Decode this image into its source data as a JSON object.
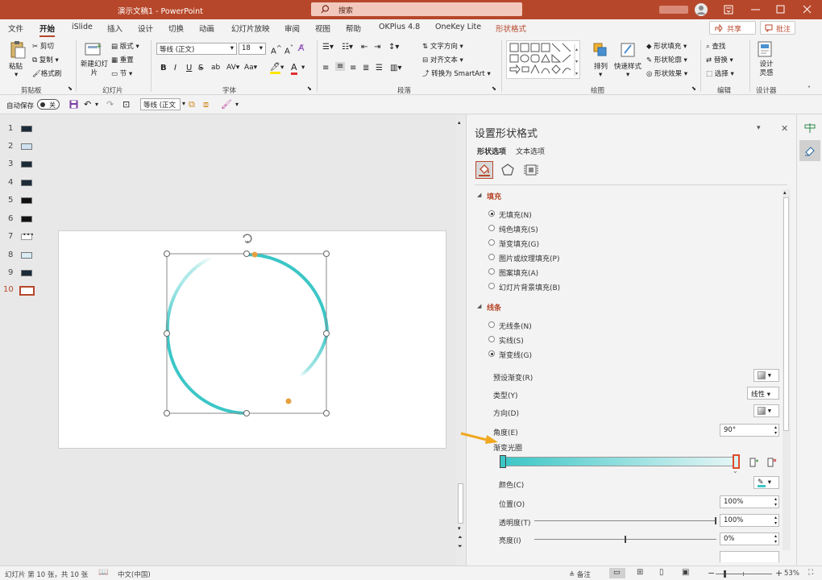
{
  "titlebar": {
    "doc_title": "演示文稿1 - PowerPoint",
    "search_placeholder": "搜索"
  },
  "tabs": [
    {
      "label": "文件"
    },
    {
      "label": "开始",
      "active": true
    },
    {
      "label": "iSlide"
    },
    {
      "label": "插入"
    },
    {
      "label": "设计"
    },
    {
      "label": "切换"
    },
    {
      "label": "动画"
    },
    {
      "label": "幻灯片放映"
    },
    {
      "label": "审阅"
    },
    {
      "label": "视图"
    },
    {
      "label": "帮助"
    },
    {
      "label": "OKPlus 4.8"
    },
    {
      "label": "OneKey Lite"
    },
    {
      "label": "形状格式"
    }
  ],
  "share_label": "共享",
  "comment_label": "批注",
  "ribbon": {
    "clipboard": {
      "paste": "粘贴",
      "cut": "剪切",
      "copy": "复制",
      "format_painter": "格式刷",
      "group": "剪贴板"
    },
    "slides": {
      "new_slide": "新建幻灯片",
      "layout": "版式",
      "reset": "重置",
      "section": "节",
      "group": "幻灯片"
    },
    "font": {
      "name": "等线 (正文)",
      "size": "18",
      "group": "字体",
      "bold": "B",
      "italic": "I",
      "underline": "U",
      "strike": "S",
      "shadow": "ab",
      "spacing": "AV",
      "case": "Aa"
    },
    "paragraph": {
      "text_direction": "文字方向",
      "align_text": "对齐文本",
      "smartart": "转换为 SmartArt",
      "group": "段落"
    },
    "drawing": {
      "arrange": "排列",
      "quick_styles": "快速样式",
      "fill": "形状填充",
      "outline": "形状轮廓",
      "effects": "形状效果",
      "group": "绘图"
    },
    "editing": {
      "find": "查找",
      "replace": "替换",
      "select": "选择",
      "group": "编辑"
    },
    "designer": {
      "ideas": "设计灵感",
      "group": "设计器"
    }
  },
  "qat": {
    "autosave_label": "自动保存",
    "autosave_state": "关",
    "font_combo": "等线 (正文"
  },
  "slides_panel": {
    "numbers": [
      "1",
      "2",
      "3",
      "4",
      "5",
      "6",
      "7",
      "8",
      "9",
      "10"
    ],
    "selected": "10"
  },
  "format_pane": {
    "title": "设置形状格式",
    "tab_shape": "形状选项",
    "tab_text": "文本选项",
    "fill_header": "填充",
    "fill_options": [
      "无填充(N)",
      "纯色填充(S)",
      "渐变填充(G)",
      "图片或纹理填充(P)",
      "图案填充(A)",
      "幻灯片背景填充(B)"
    ],
    "fill_selected": "无填充(N)",
    "line_header": "线条",
    "line_options": [
      "无线条(N)",
      "实线(S)",
      "渐变线(G)"
    ],
    "line_selected": "渐变线(G)",
    "preset_gradient": "预设渐变(R)",
    "type_label": "类型(Y)",
    "type_value": "线性",
    "direction_label": "方向(D)",
    "angle_label": "角度(E)",
    "angle_value": "90°",
    "stops_label": "渐变光圈",
    "color_label": "颜色(C)",
    "position_label": "位置(O)",
    "position_value": "100%",
    "transparency_label": "透明度(T)",
    "transparency_value": "100%",
    "transparency_fraction": 1.0,
    "brightness_label": "亮度(I)",
    "brightness_value": "0%",
    "brightness_fraction": 0.5
  },
  "statusbar": {
    "slide_info": "幻灯片 第 10 张，共 10 张",
    "language": "中文(中国)",
    "notes": "备注",
    "zoom": "53%"
  },
  "colors": {
    "brand": "#b7472a",
    "accent_teal": "#3cc6c6",
    "gradient_stop_selected": "#e04a2a"
  }
}
